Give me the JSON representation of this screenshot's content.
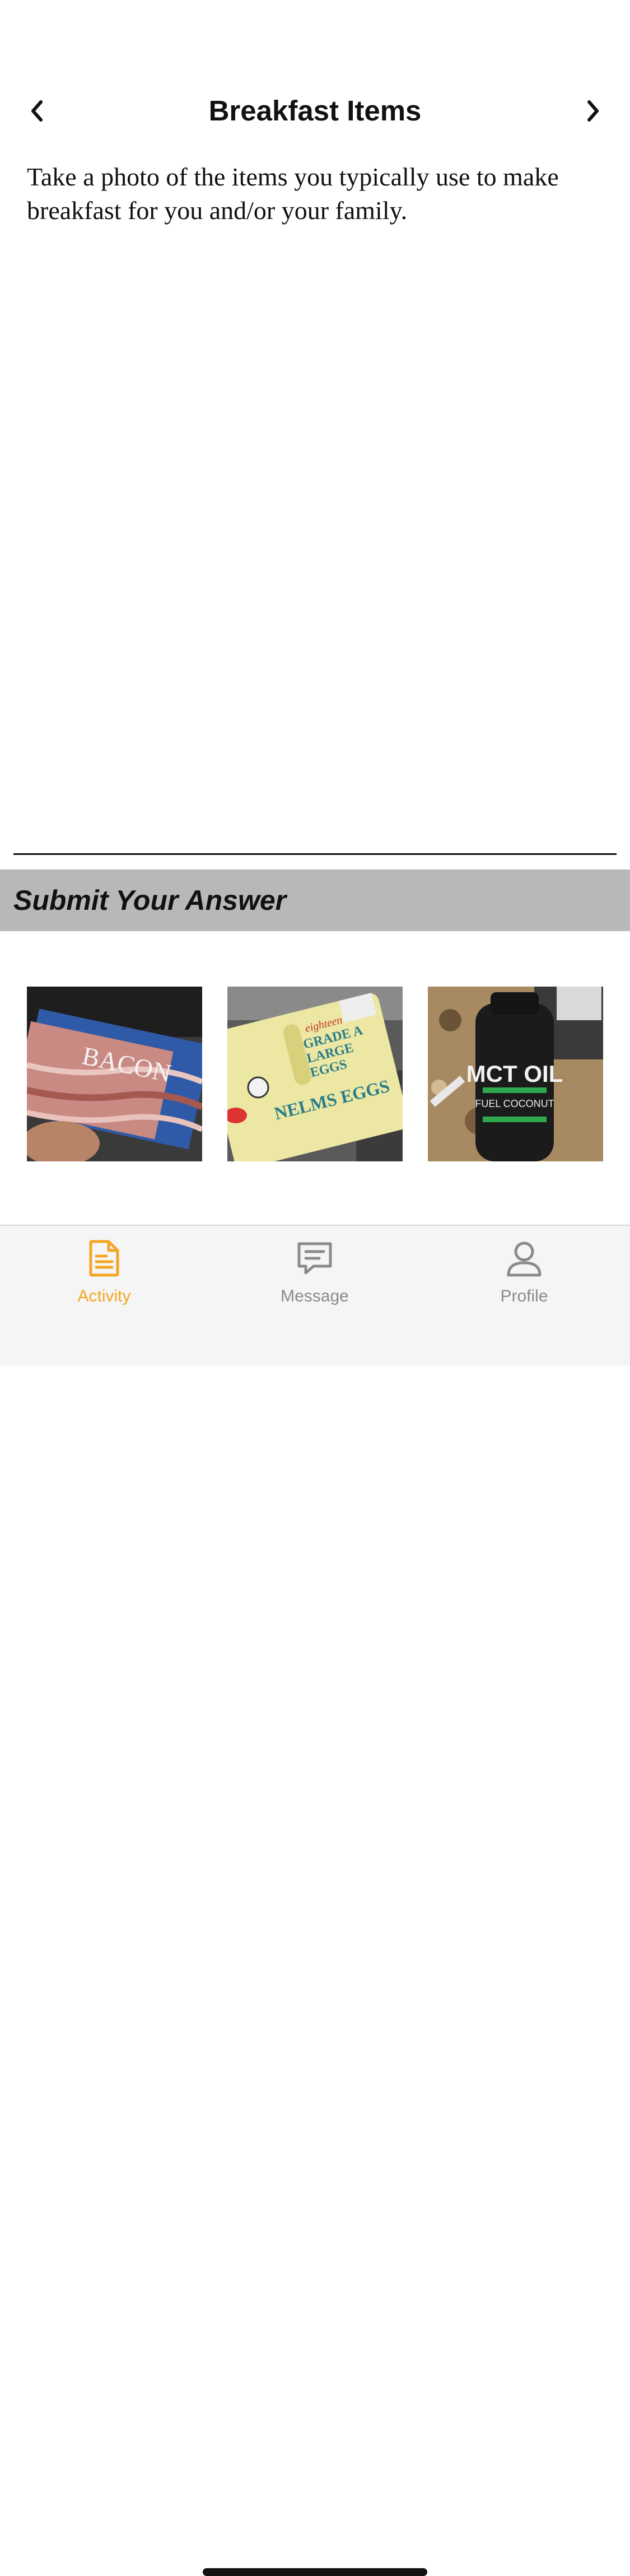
{
  "header": {
    "title": "Breakfast Items",
    "prev_icon": "chevron-left-icon",
    "next_icon": "chevron-right-icon"
  },
  "question": {
    "prompt": "Take a photo of the items you typically use to make breakfast for you and/or your family."
  },
  "answer": {
    "section_title": "Submit Your Answer",
    "photos": [
      {
        "label": "BACON"
      },
      {
        "label": "NELMS EGGS"
      },
      {
        "label": "MCT OIL"
      }
    ]
  },
  "tabbar": {
    "accent_color": "#f5a623",
    "inactive_color": "#8a8a8a",
    "tabs": [
      {
        "label": "Activity",
        "icon": "document-icon",
        "active": true
      },
      {
        "label": "Message",
        "icon": "chat-icon",
        "active": false
      },
      {
        "label": "Profile",
        "icon": "person-icon",
        "active": false
      }
    ]
  }
}
